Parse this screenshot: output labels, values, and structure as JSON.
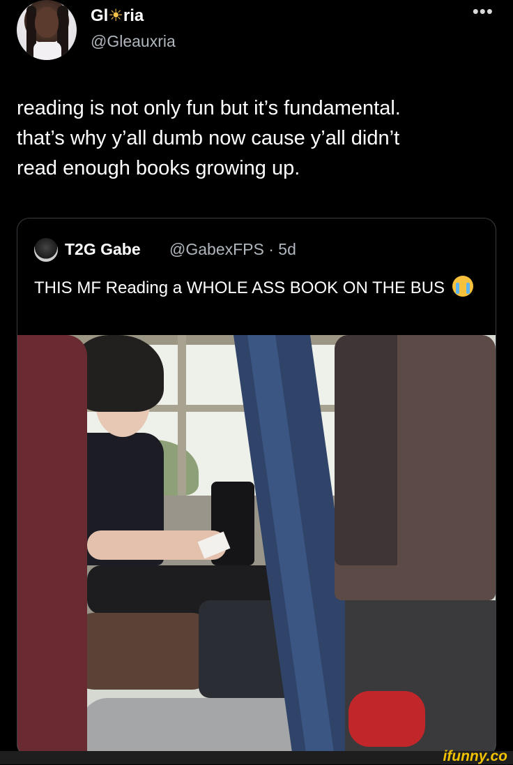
{
  "tweet": {
    "display_name": "Gl",
    "display_name_emoji": "☀",
    "display_name_end": "ria",
    "handle": "@Gleauxria",
    "more_icon": "more-dots-icon",
    "text_lines": [
      "reading is not only fun but it’s fundamental.",
      "that’s why y’all dumb now cause y’all didn’t",
      "read enough books growing up."
    ]
  },
  "quoted_tweet": {
    "name": "T2G Gabe",
    "handle": "@GabexFPS",
    "separator": "·",
    "age": "5d",
    "text": "THIS MF Reading a WHOLE ASS BOOK ON THE BUS",
    "emoji_icon": "loudly-crying-face-icon",
    "image_icon": "photo-boy-reading-on-bus"
  },
  "watermark": {
    "text": "ifunny.co",
    "color": "#f2c200"
  },
  "colors": {
    "background": "#000000",
    "text": "#ffffff",
    "secondary_text": "#b0b6bd",
    "quote_border": "#3a3f44"
  }
}
